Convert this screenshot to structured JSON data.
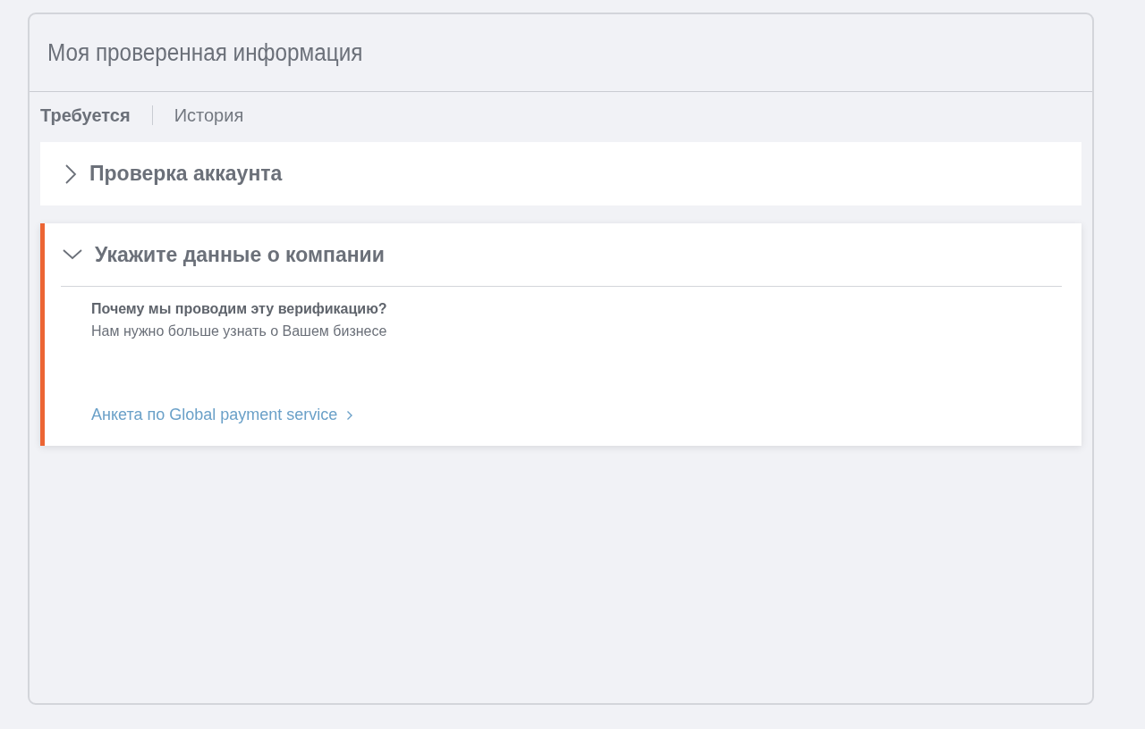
{
  "panel": {
    "title": "Моя проверенная информация"
  },
  "tabs": [
    {
      "label": "Требуется",
      "selected": true
    },
    {
      "label": "История",
      "selected": false
    }
  ],
  "sections": [
    {
      "title": "Проверка аккаунта",
      "expanded": false,
      "attention": false
    },
    {
      "title": "Укажите данные о компании",
      "expanded": true,
      "attention": true,
      "question": "Почему мы проводим эту верификацию?",
      "answer": "Нам нужно больше узнать о Вашем бизнесе",
      "link": "Анкета по Global payment service"
    }
  ]
}
